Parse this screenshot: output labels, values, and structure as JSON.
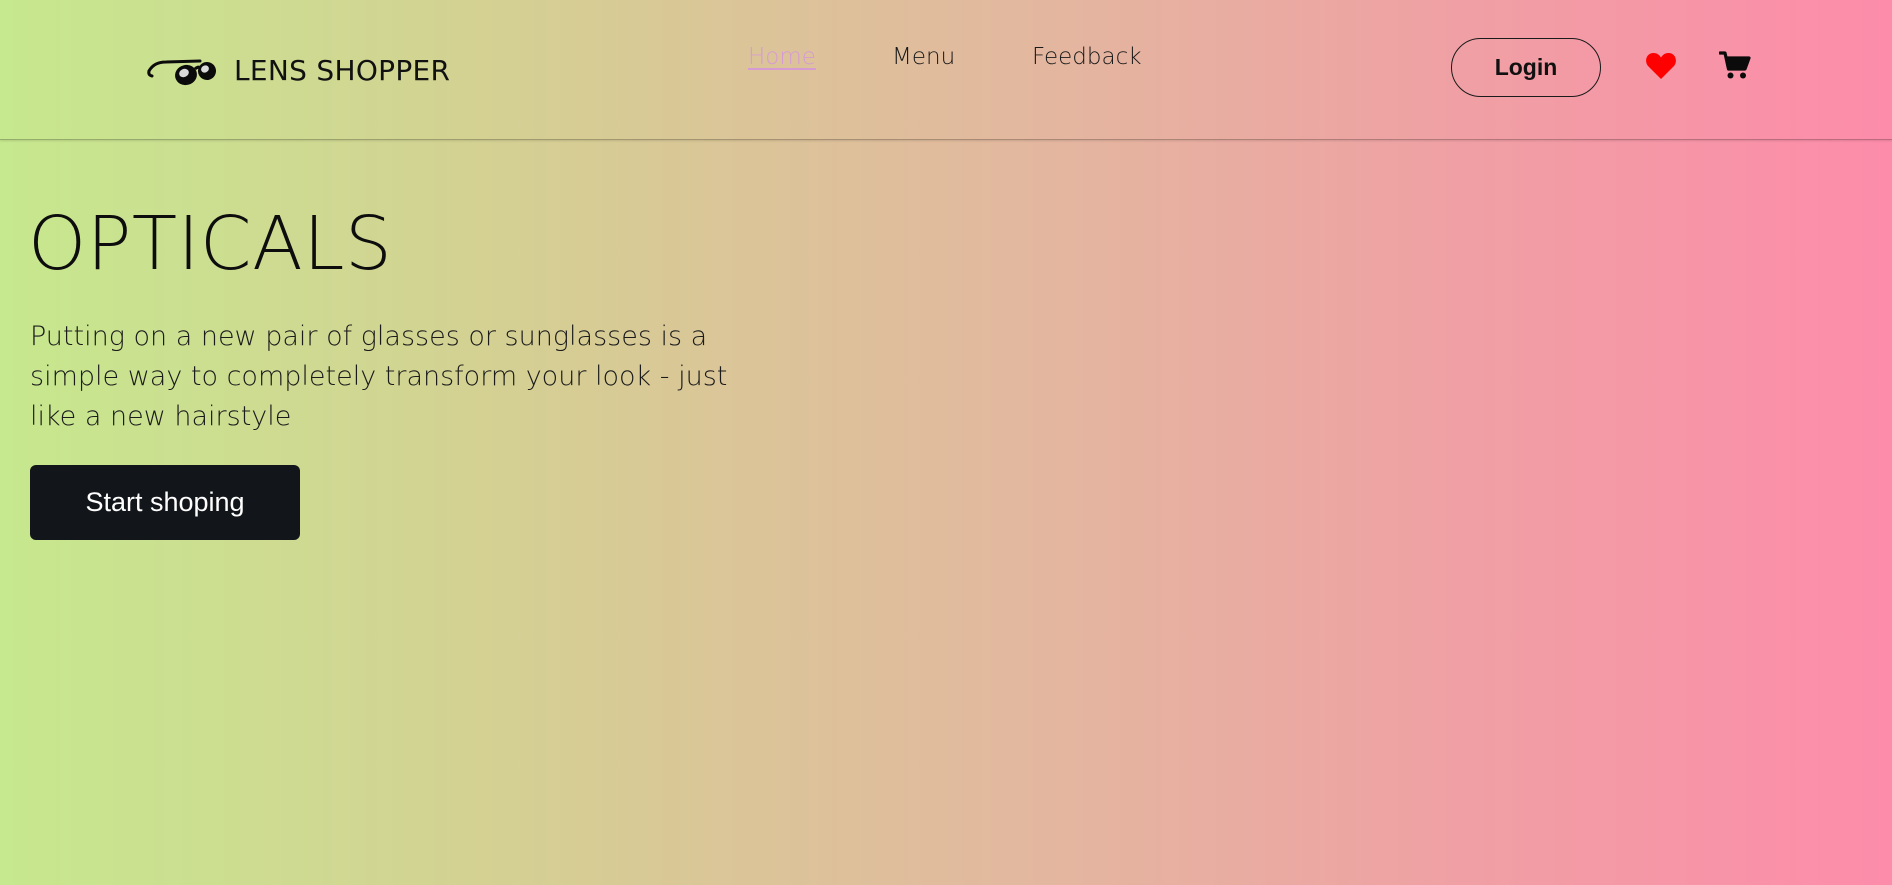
{
  "brand": {
    "name": "LENS SHOPPER",
    "icon": "sunglasses-icon"
  },
  "nav": {
    "links": [
      {
        "label": "Home",
        "active": true
      },
      {
        "label": "Menu",
        "active": false
      },
      {
        "label": "Feedback",
        "active": false
      }
    ],
    "login_label": "Login",
    "wishlist_icon": "heart-icon",
    "cart_icon": "cart-icon"
  },
  "hero": {
    "title": "OPTICALS",
    "description": "Putting on a new pair of glasses or sunglasses is a simple way to completely transform your look - just like a new hairstyle",
    "cta_label": "Start shoping"
  },
  "colors": {
    "gradient_start": "#c6e88e",
    "gradient_end": "#fd8caa",
    "active_link": "#d79bd4",
    "heart": "#ff0000",
    "cta_background": "#12161b"
  }
}
